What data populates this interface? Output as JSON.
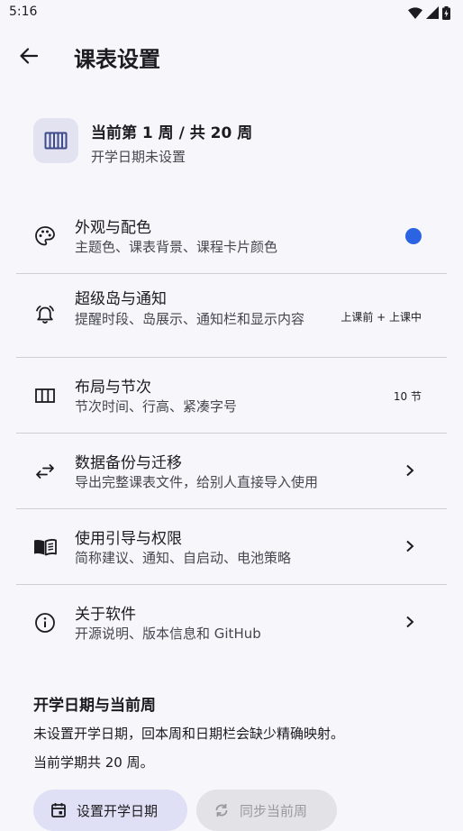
{
  "status_bar": {
    "time": "5:16"
  },
  "app_bar": {
    "title": "课表设置"
  },
  "week_card": {
    "title": "当前第 1 周 / 共 20 周",
    "subtitle": "开学日期未设置"
  },
  "settings": [
    {
      "title": "外观与配色",
      "subtitle": "主题色、课表背景、课程卡片颜色",
      "trailing_color": "#2b63e3"
    },
    {
      "title": "超级岛与通知",
      "subtitle": "提醒时段、岛展示、通知栏和显示内容",
      "trailing": "上课前 + 上课中"
    },
    {
      "title": "布局与节次",
      "subtitle": "节次时间、行高、紧凑字号",
      "trailing": "10 节"
    },
    {
      "title": "数据备份与迁移",
      "subtitle": "导出完整课表文件，给别人直接导入使用"
    },
    {
      "title": "使用引导与权限",
      "subtitle": "简称建议、通知、自启动、电池策略"
    },
    {
      "title": "关于软件",
      "subtitle": "开源说明、版本信息和 GitHub"
    }
  ],
  "term_section": {
    "title": "开学日期与当前周",
    "line1": "未设置开学日期，回本周和日期栏会缺少精确映射。",
    "line2": "当前学期共 20 周。"
  },
  "buttons": {
    "set_start_date": "设置开学日期",
    "sync_week": "同步当前周"
  },
  "colors": {
    "accent": "#2b63e3",
    "background": "#f7f6fb",
    "icon_box": "#e2e2f0",
    "primary_button": "#dfe0f5"
  }
}
